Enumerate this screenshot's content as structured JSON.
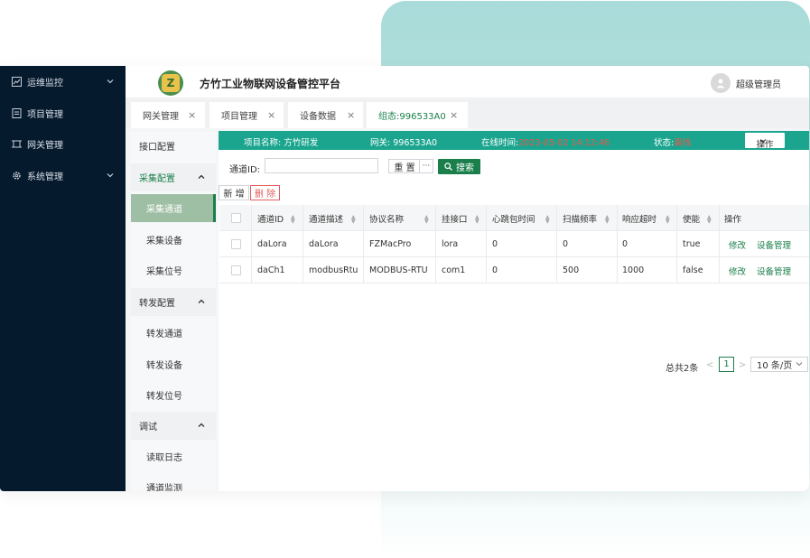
{
  "app": {
    "title": "方竹工业物联网设备管控平台",
    "logo_letter": "Z",
    "user": "超级管理员"
  },
  "sidebar": {
    "items": [
      {
        "label": "运维监控",
        "icon": "chart-icon",
        "expandable": true
      },
      {
        "label": "项目管理",
        "icon": "document-icon",
        "expandable": false
      },
      {
        "label": "网关管理",
        "icon": "gateway-icon",
        "expandable": false
      },
      {
        "label": "系统管理",
        "icon": "gear-icon",
        "expandable": true
      }
    ]
  },
  "tabs": [
    {
      "label": "网关管理",
      "active": false
    },
    {
      "label": "项目管理",
      "active": false
    },
    {
      "label": "设备数据",
      "active": false
    },
    {
      "label": "组态:996533A0",
      "active": true
    }
  ],
  "submenu": {
    "interface": "接口配置",
    "collect_group": "采集配置",
    "collect_items": [
      "采集通道",
      "采集设备",
      "采集位号"
    ],
    "forward_group": "转发配置",
    "forward_items": [
      "转发通道",
      "转发设备",
      "转发位号"
    ],
    "debug_group": "调试",
    "debug_items": [
      "读取日志",
      "通道监测"
    ]
  },
  "infobar": {
    "project_label": "项目名称:",
    "project_value": "方竹研发",
    "gateway_label": "网关:",
    "gateway_value": "996533A0",
    "online_label": "在线时间:",
    "online_value": "2023-05-02 14:12:46",
    "status_label": "状态:",
    "status_value": "离线",
    "op_label": "操作"
  },
  "filter": {
    "label": "通道ID:",
    "value": "",
    "reset": "重 置",
    "more": "···",
    "search": "搜索"
  },
  "actions": {
    "add": "新 增",
    "delete": "删 除"
  },
  "table": {
    "columns": [
      "通道ID",
      "通道描述",
      "协议名称",
      "挂接口",
      "心跳包时间",
      "扫描频率",
      "响应超时",
      "使能",
      "操作"
    ],
    "rows": [
      {
        "id": "daLora",
        "desc": "daLora",
        "protocol": "FZMacPro",
        "port": "lora",
        "heartbeat": "0",
        "scan": "0",
        "timeout": "0",
        "enable": "true",
        "edit": "修改",
        "manage": "设备管理"
      },
      {
        "id": "daCh1",
        "desc": "modbusRtu",
        "protocol": "MODBUS-RTU",
        "port": "com1",
        "heartbeat": "0",
        "scan": "500",
        "timeout": "1000",
        "enable": "false",
        "edit": "修改",
        "manage": "设备管理"
      }
    ]
  },
  "pagination": {
    "total": "总共2条",
    "prev": "<",
    "current": "1",
    "next": ">",
    "page_size": "10 条/页"
  },
  "colors": {
    "sidebar": "#061a2e",
    "accent": "#1a7f4b",
    "infobar": "#1ba58f",
    "danger": "#e25b5b"
  }
}
